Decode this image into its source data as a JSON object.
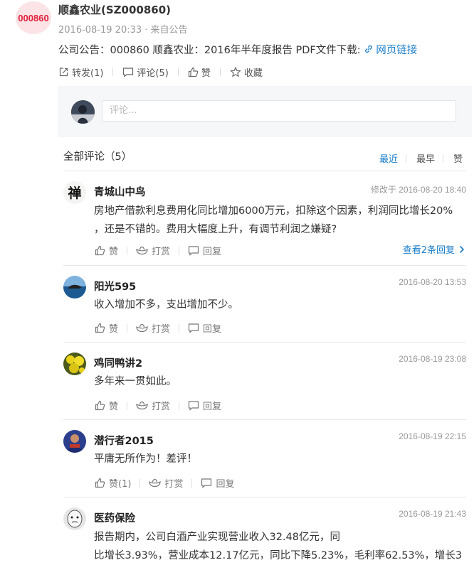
{
  "post": {
    "stock_code": "000860",
    "author": "顺鑫农业(SZ000860)",
    "meta": "2016-08-19 20:33 · 来自公告",
    "content": "公司公告：000860 顺鑫农业：2016年半年度报告 PDF文件下载: ",
    "link_label": "网页链接",
    "actions": {
      "forward": "转发(1)",
      "comment": "评论(5)",
      "like": "赞",
      "favorite": "收藏"
    }
  },
  "comment_input": {
    "placeholder": "评论..."
  },
  "comments_header": {
    "title": "全部评论（5）",
    "sort": [
      "最近",
      "最早",
      "赞"
    ]
  },
  "comments": [
    {
      "user": "青城山中鸟",
      "time": "修改于 2016-08-20 18:40",
      "text": [
        "房地产借款利息费用化同比增加6000万元，扣除这个因素，利润同比增长20%",
        "，还是不错的。费用大幅度上升，有调节利润之嫌疑?"
      ],
      "like": "赞",
      "tip": "打赏",
      "reply": "回复",
      "replies": "查看2条回复"
    },
    {
      "user": "阳光595",
      "time": "2016-08-20 13:53",
      "text": [
        "收入增加不多，支出增加不少。"
      ],
      "like": "赞",
      "tip": "打赏",
      "reply": "回复"
    },
    {
      "user": "鸡同鸭讲2",
      "time": "2016-08-19 23:08",
      "text": [
        "多年来一贯如此。"
      ],
      "like": "赞",
      "tip": "打赏",
      "reply": "回复"
    },
    {
      "user": "潜行者2015",
      "time": "2016-08-19 22:15",
      "text": [
        "平庸无所作为！差评！"
      ],
      "like": "赞(1)",
      "tip": "打赏",
      "reply": "回复"
    },
    {
      "user": "医药保险",
      "time": "2016-08-19 21:43",
      "text": [
        "报告期内，公司白酒产业实现营业收入32.48亿元，同",
        "比增长3.93%，营业成本12.17亿元，同比下降5.23%，毛利率62.53%，增长3"
      ]
    }
  ],
  "colors": {
    "accent": "#1a7ec9",
    "stock_red": "#e0213b"
  }
}
